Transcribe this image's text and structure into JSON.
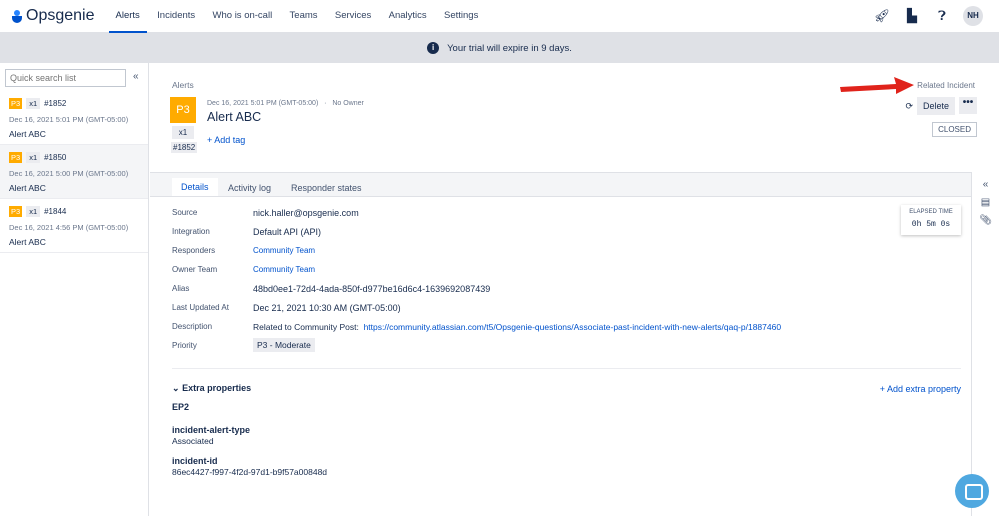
{
  "nav": {
    "brand": "Opsgenie",
    "items": [
      "Alerts",
      "Incidents",
      "Who is on-call",
      "Teams",
      "Services",
      "Analytics",
      "Settings"
    ],
    "avatar": "NH"
  },
  "banner": "Your trial will expire in 9 days.",
  "sidebar": {
    "search_placeholder": "Quick search list",
    "items": [
      {
        "priority": "P3",
        "count": "x1",
        "num": "#1852",
        "date": "Dec 16, 2021 5:01 PM (GMT-05:00)",
        "title": "Alert ABC"
      },
      {
        "priority": "P3",
        "count": "x1",
        "num": "#1850",
        "date": "Dec 16, 2021 5:00 PM (GMT-05:00)",
        "title": "Alert ABC"
      },
      {
        "priority": "P3",
        "count": "x1",
        "num": "#1844",
        "date": "Dec 16, 2021 4:56 PM (GMT-05:00)",
        "title": "Alert ABC"
      }
    ]
  },
  "alert": {
    "breadcrumb": "Alerts",
    "priority": "P3",
    "count": "x1",
    "num": "#1852",
    "date": "Dec 16, 2021 5:01 PM (GMT-05:00)",
    "sep": "·",
    "owner": "No Owner",
    "title": "Alert ABC",
    "add_tag": "+ Add tag",
    "related": "Related Incident",
    "delete": "Delete",
    "more": "•••",
    "status": "CLOSED"
  },
  "tabs": [
    "Details",
    "Activity log",
    "Responder states"
  ],
  "details": [
    {
      "label": "Source",
      "value": "nick.haller@opsgenie.com"
    },
    {
      "label": "Integration",
      "value": "Default API (API)"
    },
    {
      "label": "Responders",
      "value": "Community Team"
    },
    {
      "label": "Owner Team",
      "value": "Community Team"
    },
    {
      "label": "Alias",
      "value": "48bd0ee1-72d4-4ada-850f-d977be16d6c4-1639692087439"
    },
    {
      "label": "Last Updated At",
      "value": "Dec 21, 2021 10:30 AM (GMT-05:00)"
    },
    {
      "label": "Description",
      "value": "Related to Community Post:",
      "link": "https://community.atlassian.com/t5/Opsgenie-questions/Associate-past-incident-with-new-alerts/qaq-p/1887460"
    },
    {
      "label": "Priority",
      "value": "P3 - Moderate"
    }
  ],
  "elapsed": {
    "label": "ELAPSED TIME",
    "value": "0h 5m 0s"
  },
  "extra": {
    "title": "Extra properties",
    "add": "+ Add extra property",
    "group": "EP2",
    "props": [
      {
        "key": "incident-alert-type",
        "value": "Associated"
      },
      {
        "key": "incident-id",
        "value": "86ec4427-f997-4f2d-97d1-b9f57a00848d"
      }
    ]
  }
}
